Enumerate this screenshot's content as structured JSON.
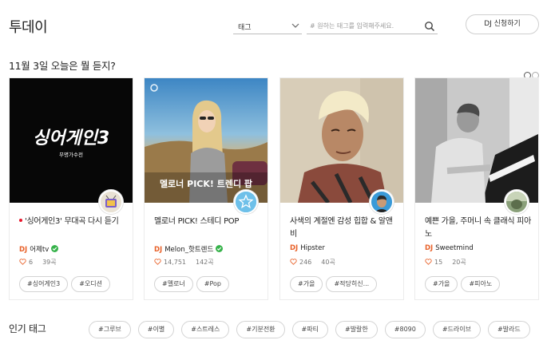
{
  "header": {
    "title": "투데이",
    "tag_select_value": "태그",
    "search_placeholder": "# 원하는 태그를 입력해주세요.",
    "dj_apply_label": "DJ 신청하기"
  },
  "section": {
    "title": "11월 3일 오늘은 뭘 듣지?"
  },
  "cards": [
    {
      "title": "'싱어게인3' 무대곡 다시 듣기",
      "is_new": true,
      "thumb_text_main": "싱어게인3",
      "thumb_text_sub": "무명가수전",
      "dj_prefix": "DJ",
      "dj_name": "어제tv",
      "verified": true,
      "likes": "6",
      "tracks": "39곡",
      "tags": [
        "#싱어게인3",
        "#오디션"
      ]
    },
    {
      "title": "멜로너 PICK! 스테디 POP",
      "is_new": false,
      "thumb_overlay": "멜로너 PICK! 트렌디 팝",
      "dj_prefix": "DJ",
      "dj_name": "Melon_핫트렌드",
      "verified": true,
      "likes": "14,751",
      "tracks": "142곡",
      "tags": [
        "#멜로너",
        "#Pop"
      ]
    },
    {
      "title": "사색의 계절엔 감성 힙합 & 알앤비",
      "is_new": false,
      "dj_prefix": "DJ",
      "dj_name": "Hipster",
      "verified": false,
      "likes": "246",
      "tracks": "40곡",
      "tags": [
        "#가을",
        "#적당히신..."
      ]
    },
    {
      "title": "예쁜 가을, 주머니 속 클래식 피아노",
      "is_new": false,
      "dj_prefix": "DJ",
      "dj_name": "Sweetmind",
      "verified": false,
      "likes": "15",
      "tracks": "20곡",
      "tags": [
        "#가을",
        "#피아노"
      ]
    }
  ],
  "popular": {
    "title": "인기 태그",
    "tags": [
      "#그루브",
      "#이별",
      "#스트레스",
      "#기분전환",
      "#파티",
      "#발랄한",
      "#8090",
      "#드라이브",
      "#발라드"
    ]
  },
  "colors": {
    "accent_dj": "#e8622a",
    "verified_green": "#36b24a",
    "new_dot_red": "#e8162b",
    "star_badge_blue": "#6ec0e9"
  }
}
